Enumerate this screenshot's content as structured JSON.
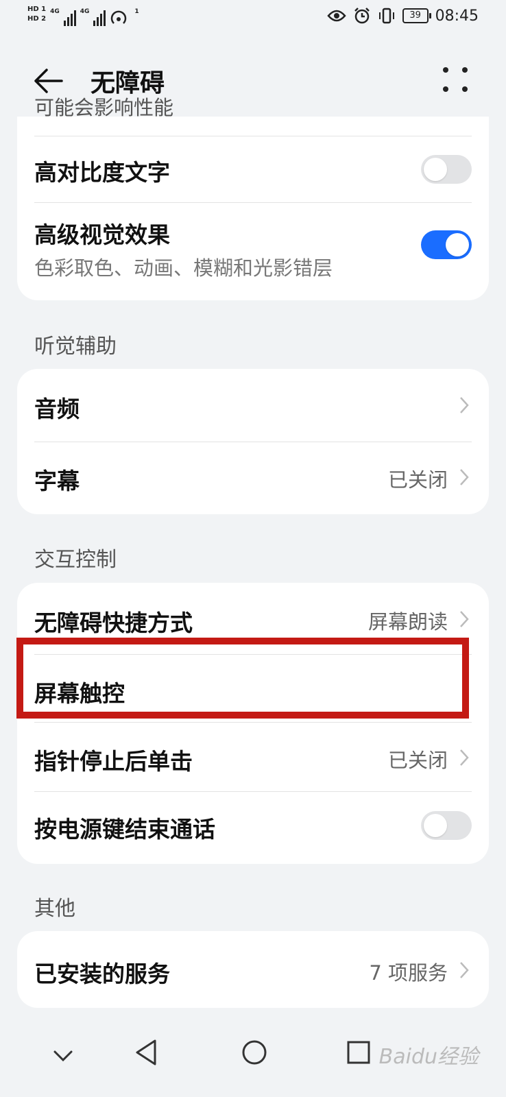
{
  "status_bar": {
    "sim1": "HD 1",
    "sim2": "HD 2",
    "network1": "4G",
    "network2": "4G",
    "hotspot_count": "1",
    "battery": "39",
    "time": "08:45",
    "icons": [
      "eye-icon",
      "alarm-icon",
      "vibrate-icon",
      "battery-icon"
    ]
  },
  "app_bar": {
    "title": "无障碍",
    "back_icon": "arrow-left-icon",
    "more_icon": "more-dots-icon"
  },
  "display_section": {
    "cut_off_text": "可能会影响性能",
    "items": [
      {
        "label": "高对比度文字",
        "toggle": false
      },
      {
        "label": "高级视觉效果",
        "subtitle": "色彩取色、动画、模糊和光影错层",
        "toggle": true
      }
    ]
  },
  "hearing_section": {
    "header": "听觉辅助",
    "items": [
      {
        "label": "音频",
        "value": ""
      },
      {
        "label": "字幕",
        "value": "已关闭"
      }
    ]
  },
  "interaction_section": {
    "header": "交互控制",
    "items": [
      {
        "label": "无障碍快捷方式",
        "value": "屏幕朗读"
      },
      {
        "label": "屏幕触控",
        "value": "",
        "highlighted": true
      },
      {
        "label": "指针停止后单击",
        "value": "已关闭"
      },
      {
        "label": "按电源键结束通话",
        "toggle": false
      }
    ]
  },
  "other_section": {
    "header": "其他",
    "items": [
      {
        "label": "已安装的服务",
        "value": "7 项服务"
      }
    ]
  },
  "nav_bar": {
    "buttons": [
      "chevron-down-icon",
      "back-triangle-icon",
      "home-circle-icon",
      "recents-square-icon"
    ]
  },
  "watermark": "Baidu经验",
  "colors": {
    "background": "#f1f3f5",
    "card": "#ffffff",
    "toggle_on": "#1a6dff",
    "highlight_border": "#c41a14"
  }
}
